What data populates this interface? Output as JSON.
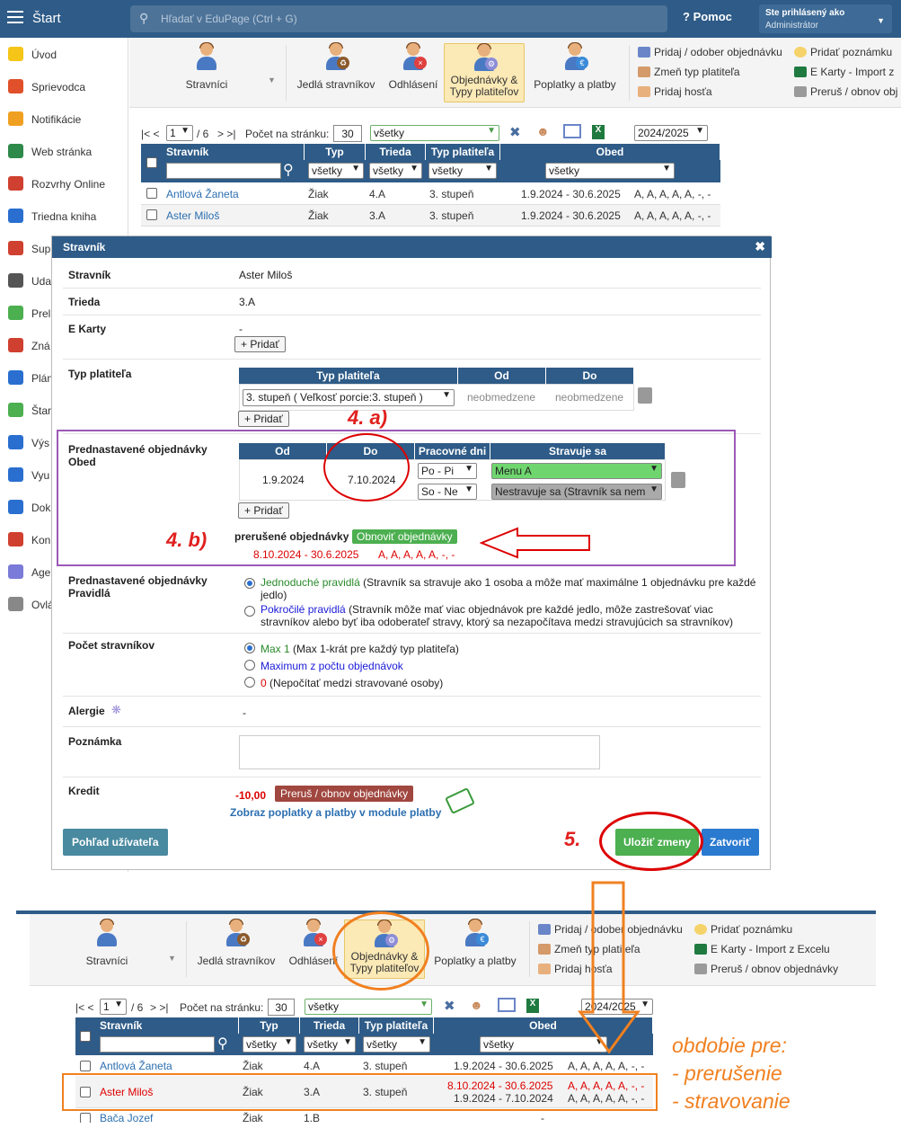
{
  "topbar": {
    "title": "Štart",
    "search_placeholder": "Hľadať v EduPage (Ctrl + G)",
    "help": "Pomoc",
    "user_line1": "Ste prihlásený ako",
    "user_line2": "Administrátor"
  },
  "sidebar": [
    "Úvod",
    "Sprievodca",
    "Notifikácie",
    "Web stránka",
    "Rozvrhy Online",
    "Triedna kniha",
    "Sup",
    "Uda",
    "Prel",
    "Zná",
    "Plán",
    "Štar",
    "Výs",
    "Vyu",
    "Dok",
    "Kon",
    "Age",
    "Ovlá"
  ],
  "ribbon": {
    "stravnici": "Stravníci",
    "jedla": "Jedlá stravníkov",
    "odhlasenie": "Odhlásení",
    "obj1": "Objednávky &",
    "obj2": "Typy platiteľov",
    "poplatky": "Poplatky a platby",
    "actions": [
      "Pridaj / odober objednávku",
      "Zmeň typ platiteľa",
      "Pridaj hosťa",
      "Pridať poznámku",
      "E Karty - Import z Excelu",
      "Preruš / obnov objednávky"
    ],
    "actions_top": [
      "Pridaj / odober objednávku",
      "Zmeň typ platiteľa",
      "Pridaj hosťa",
      "Pridať poznámku",
      "E Karty - Import z",
      "Preruš / obnov obj"
    ]
  },
  "pager": {
    "first": "|<",
    "prev": "<",
    "page": "1",
    "of": "/ 6",
    "next": ">",
    "last": ">|",
    "per_page_label": "Počet na stránku:",
    "per_page": "30",
    "filter": "všetky",
    "year": "2024/2025"
  },
  "table": {
    "headers": [
      "Stravník",
      "Typ",
      "Trieda",
      "Typ platiteľa",
      "Obed"
    ],
    "filter": "všetky",
    "rows": [
      {
        "name": "Antlová Žaneta",
        "typ": "Žiak",
        "trieda": "4.A",
        "platitel": "3. stupeň",
        "obdobie": "1.9.2024 - 30.6.2025",
        "obed": "A, A, A, A, A, -, -"
      },
      {
        "name": "Aster Miloš",
        "typ": "Žiak",
        "trieda": "3.A",
        "platitel": "3. stupeň",
        "obdobie": "1.9.2024 - 30.6.2025",
        "obed": "A, A, A, A, A, -, -"
      }
    ]
  },
  "modal": {
    "title": "Stravník",
    "close": "✖",
    "stravnik_label": "Stravník",
    "stravnik": "Aster Miloš",
    "trieda_label": "Trieda",
    "trieda": "3.A",
    "ekarty_label": "E Karty",
    "ekarty": "-",
    "add": "+ Pridať",
    "typ_label": "Typ platiteľa",
    "typ_headers": [
      "Typ platiteľa",
      "Od",
      "Do"
    ],
    "typ_select": "3. stupeň ( Veľkosť porcie:3. stupeň )",
    "typ_od": "neobmedzene",
    "typ_do": "neobmedzene",
    "pred_label1": "Prednastavené objednávky",
    "pred_label2": "Obed",
    "pred_headers": [
      "Od",
      "Do",
      "Pracovné dni",
      "Stravuje sa"
    ],
    "pred_od": "1.9.2024",
    "pred_do": "7.10.2024",
    "days1": "Po - Pi",
    "days2": "So - Ne",
    "menu1": "Menu A",
    "menu2": "Nestravuje sa (Stravník sa nem",
    "prerusene_label": "prerušené objednávky",
    "obnovit": "Obnoviť objednávky",
    "prerusene_obdobie": "8.10.2024 - 30.6.2025",
    "prerusene_obed": "A, A, A, A, A, -, -",
    "prav_label1": "Prednastavené objednávky",
    "prav_label2": "Pravidlá",
    "prav1_title": "Jednoduché pravidlá",
    "prav1_text": "(Stravník sa stravuje ako 1 osoba a môže mať maximálne 1 objednávku pre každé",
    "prav1_text2": "jedlo)",
    "prav2_title": "Pokročilé pravidlá",
    "prav2_text": "(Stravník môže mať viac objednávok pre každé jedlo, môže zastrešovať viac",
    "prav2_text2": "stravníkov alebo byť iba odoberateľ stravy, ktorý sa nezapočítava medzi stravujúcich sa stravníkov)",
    "pocet_label": "Počet stravníkov",
    "pocet1_title": "Max 1",
    "pocet1_text": "(Max 1-krát pre každý typ platiteľa)",
    "pocet2_title": "Maximum z počtu objednávok",
    "pocet3_title": "0",
    "pocet3_text": "(Nepočítať medzi stravované osoby)",
    "alergie_label": "Alergie",
    "alergie": "-",
    "poznamka_label": "Poznámka",
    "kredit_label": "Kredit",
    "kredit": "-10,00",
    "prerus": "Preruš / obnov objednávky",
    "zobraz": "Zobraz poplatky a platby v module platby",
    "pohlad": "Pohľad užívateľa",
    "ulozit": "Uložiť zmeny",
    "zatvorit": "Zatvoriť"
  },
  "annotations": {
    "a": "4. a)",
    "b": "4. b)",
    "five": "5.",
    "obdobie1": "obdobie pre:",
    "obdobie2": "- prerušenie",
    "obdobie3": "- stravovanie"
  },
  "bottom_table": {
    "rows": [
      {
        "name": "Antlová Žaneta",
        "typ": "Žiak",
        "trieda": "4.A",
        "platitel": "3. stupeň",
        "obdobie": "1.9.2024 - 30.6.2025",
        "obed": "A, A, A, A, A, -, -"
      },
      {
        "name": "Aster Miloš",
        "typ": "Žiak",
        "trieda": "3.A",
        "platitel": "3. stupeň",
        "obdobie1": "8.10.2024 - 30.6.2025",
        "obed1": "A, A, A, A, A, -, -",
        "obdobie2": "1.9.2024 - 7.10.2024",
        "obed2": "A, A, A, A, A, -, -"
      },
      {
        "name": "Bača Jozef",
        "typ": "Žiak",
        "trieda": "1.B",
        "platitel": "",
        "obdobie": "-",
        "obed": ""
      }
    ]
  },
  "colors": {
    "primary": "#2e5b87",
    "red": "#d00",
    "green": "#2a8a2a",
    "orange": "#f08020",
    "purple": "#9b59b6"
  }
}
